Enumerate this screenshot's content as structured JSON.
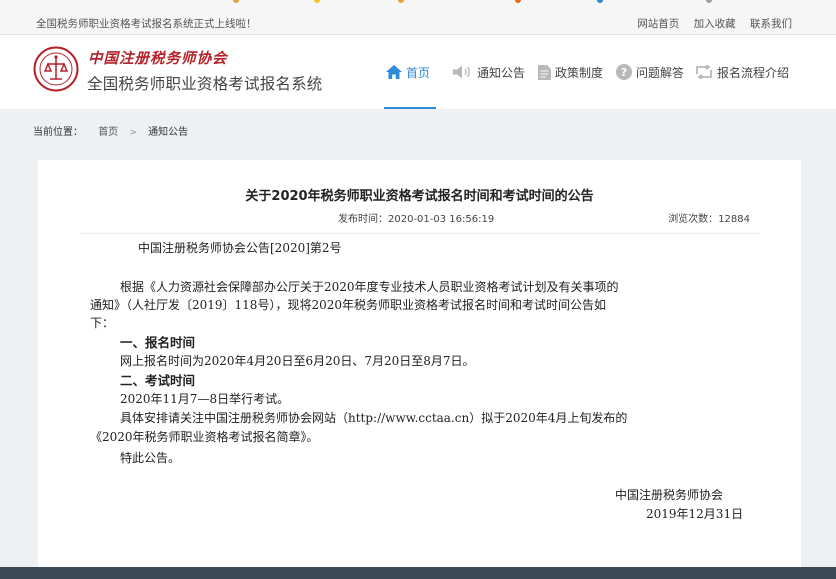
{
  "topbar": {
    "notice": "全国税务师职业资格考试报名系统正式上线啦！",
    "links": [
      "网站首页",
      "加入收藏",
      "联系我们"
    ]
  },
  "header": {
    "logo_line1": "中国注册税务师协会",
    "logo_line2": "全国税务师职业资格考试报名系统",
    "nav": [
      {
        "label": "首页",
        "icon": "home-icon",
        "active": true
      },
      {
        "label": "通知公告",
        "icon": "speaker-icon",
        "active": false
      },
      {
        "label": "政策制度",
        "icon": "document-icon",
        "active": false
      },
      {
        "label": "问题解答",
        "icon": "question-icon",
        "active": false
      },
      {
        "label": "报名流程介绍",
        "icon": "cycle-icon",
        "active": false
      }
    ]
  },
  "breadcrumb": {
    "label": "当前位置：",
    "home": "首页",
    "current": "通知公告"
  },
  "article": {
    "title": "关于2020年税务师职业资格考试报名时间和考试时间的公告",
    "publish_label": "发布时间：",
    "publish_time": "2020-01-03 16:56:19",
    "views_label": "浏览次数：",
    "views": "12884",
    "doc_number": "中国注册税务师协会公告[2020]第2号",
    "para1_line1": "根据《人力资源社会保障部办公厅关于2020年度专业技术人员职业资格考试计划及有关事项的",
    "para1_line2": "通知》（人社厅发〔2019〕118号），现将2020年税务师职业资格考试报名时间和考试时间公告如",
    "para1_line3": "下：",
    "heading1": "一、报名时间",
    "line_reg": "网上报名时间为2020年4月20日至6月20日、7月20日至8月7日。",
    "heading2": "二、考试时间",
    "line_exam": "2020年11月7—8日举行考试。",
    "line_detail1": "具体安排请关注中国注册税务师协会网站（http://www.cctaa.cn）拟于2020年4月上旬发布的",
    "line_detail2": "《2020年税务师职业资格考试报名简章》。",
    "closing": "特此公告。",
    "signature": "中国注册税务师协会",
    "date": "2019年12月31日"
  },
  "colors": {
    "accent": "#2f8ad8",
    "brand_red": "#b3232a",
    "footer": "#3b4a55"
  }
}
